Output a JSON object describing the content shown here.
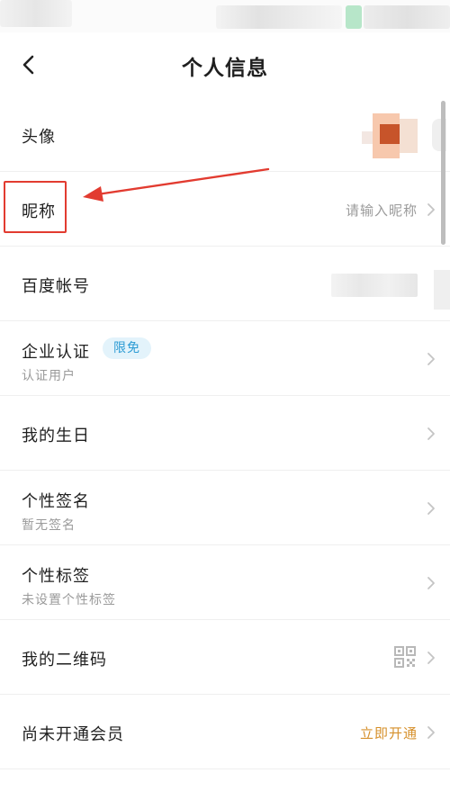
{
  "header": {
    "title": "个人信息",
    "back_icon": "chevron-left-icon"
  },
  "rows": {
    "avatar": {
      "label": "头像"
    },
    "nickname": {
      "label": "昵称",
      "placeholder": "请输入昵称"
    },
    "baidu_account": {
      "label": "百度帐号"
    },
    "enterprise": {
      "label": "企业认证",
      "badge": "限免",
      "sub": "认证用户"
    },
    "birthday": {
      "label": "我的生日"
    },
    "signature": {
      "label": "个性签名",
      "sub": "暂无签名"
    },
    "tags": {
      "label": "个性标签",
      "sub": "未设置个性标签"
    },
    "qrcode": {
      "label": "我的二维码",
      "icon": "qr-code-icon"
    },
    "vip": {
      "label": "尚未开通会员",
      "action": "立即开通"
    }
  },
  "colors": {
    "accent_orange": "#d6902b",
    "badge_blue": "#2b9bd4",
    "badge_bg": "#e3f3fb",
    "annotation_red": "#e23b30"
  }
}
